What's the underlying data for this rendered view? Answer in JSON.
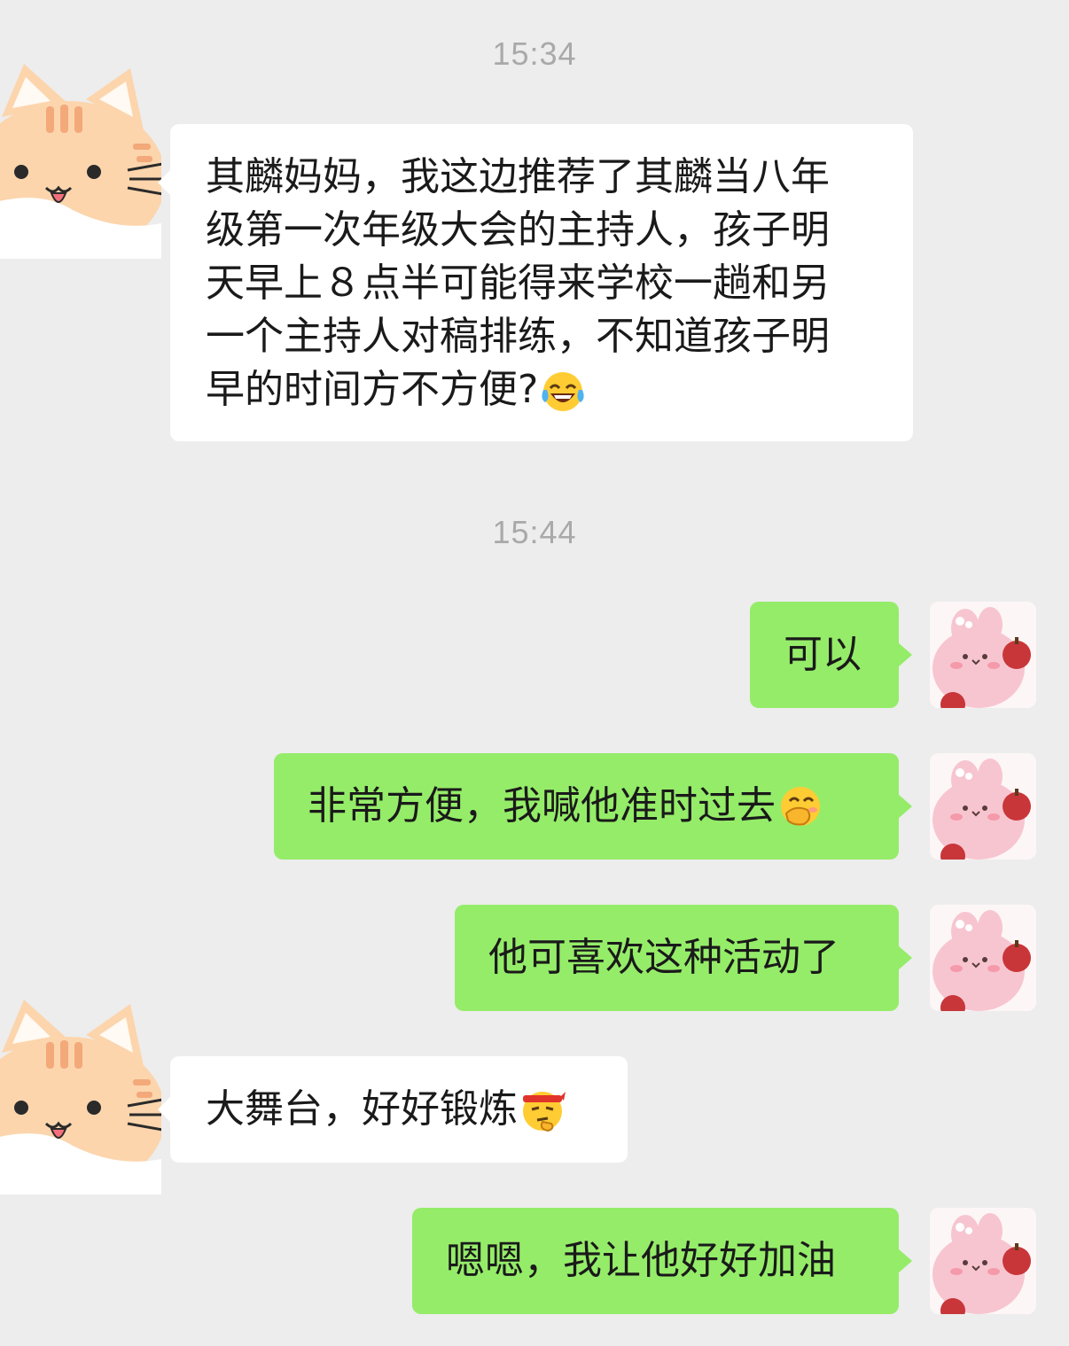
{
  "chat": {
    "timestamps": [
      "15:34",
      "15:44"
    ],
    "messages": [
      {
        "sender": "other",
        "avatar": "cat-avatar",
        "lines": [
          "其麟妈妈，我这边推荐了其麟当八年",
          "级第一次年级大会的主持人，孩子明",
          "天早上８点半可能得来学校一趟和另",
          "一个主持人对稿排练，不知道孩子明",
          "早的时间方不方便?"
        ],
        "emoji": "tears-of-joy-emoji"
      },
      {
        "sender": "me",
        "avatar": "bunny-avatar",
        "text": "可以"
      },
      {
        "sender": "me",
        "avatar": "bunny-avatar",
        "text": "非常方便，我喊他准时过去",
        "emoji": "hand-over-mouth-emoji"
      },
      {
        "sender": "me",
        "avatar": "bunny-avatar",
        "text": "他可喜欢这种活动了"
      },
      {
        "sender": "other",
        "avatar": "cat-avatar",
        "text": "大舞台，好好锻炼",
        "emoji": "thinking-headband-emoji"
      },
      {
        "sender": "me",
        "avatar": "bunny-avatar",
        "text": "嗯嗯，我让他好好加油"
      }
    ]
  },
  "colors": {
    "background": "#ededed",
    "incoming_bubble": "#ffffff",
    "outgoing_bubble": "#95ec69",
    "timestamp": "#a9a9a9"
  }
}
